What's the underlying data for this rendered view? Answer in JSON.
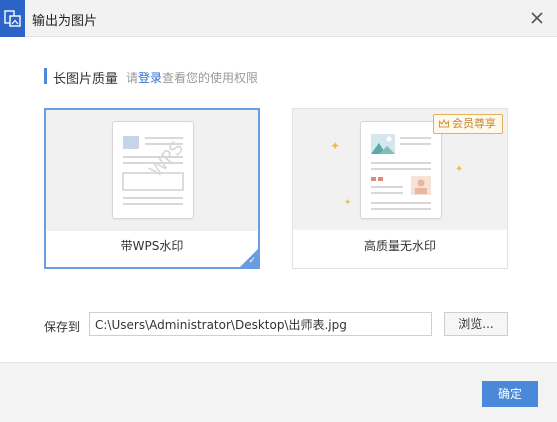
{
  "window": {
    "title": "输出为图片",
    "close_icon": "close-icon"
  },
  "section": {
    "title": "长图片质量",
    "hint_prefix": "请",
    "hint_link": "登录",
    "hint_suffix": "查看您的使用权限"
  },
  "options": [
    {
      "label": "带WPS水印",
      "selected": true,
      "watermark_text": "WPS"
    },
    {
      "label": "高质量无水印",
      "selected": false,
      "badge": "会员尊享"
    }
  ],
  "save": {
    "label": "保存到",
    "path": "C:\\Users\\Administrator\\Desktop\\出师表.jpg",
    "browse_label": "浏览..."
  },
  "footer": {
    "ok_label": "确定"
  },
  "colors": {
    "accent": "#4a88d9",
    "selected_border": "#6b9be0",
    "vip_gold": "#e6b15c",
    "title_icon": "#2b64c6"
  }
}
